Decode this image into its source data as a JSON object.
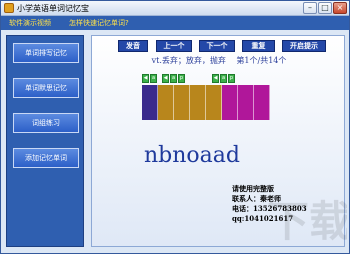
{
  "window": {
    "title": "小学英语单词记忆宝",
    "controls": {
      "minimize": "–",
      "maximize": "□",
      "close": "×"
    }
  },
  "menu": [
    {
      "label": "软件演示视频"
    },
    {
      "label": "怎样快速记忆单词?"
    }
  ],
  "sidebar": {
    "items": [
      {
        "label": "单词排写记忆"
      },
      {
        "label": "单词默思记忆"
      },
      {
        "label": "词组练习"
      },
      {
        "label": "添加记忆单词"
      }
    ]
  },
  "controls": {
    "pronounce": "发音",
    "prev": "上一个",
    "next": "下一个",
    "repeat": "重复",
    "hint": "开启提示"
  },
  "word": {
    "definition": "vt.丢弃；放弃，抛弃",
    "position": "第1个/共14个",
    "scrambled": "nbnoaad",
    "tag_icons": [
      "sound-icon",
      "a-icon",
      "p-icon"
    ],
    "letter_colors": [
      "#3a2a8c",
      "#b8861c",
      "#b8861c",
      "#b8861c",
      "#b8861c",
      "#b0179a",
      "#b0179a",
      "#b0179a"
    ]
  },
  "contact": {
    "line1": "请使用完整版",
    "line2": "联系人：秦老师",
    "line3": "电话：13526783803",
    "line4": "qq:1041021617"
  },
  "colors": {
    "sidebar": "#2f5fb0",
    "button": "#2448a8",
    "menu_text": "#ffe24a",
    "word_text": "#1f3a9c"
  }
}
